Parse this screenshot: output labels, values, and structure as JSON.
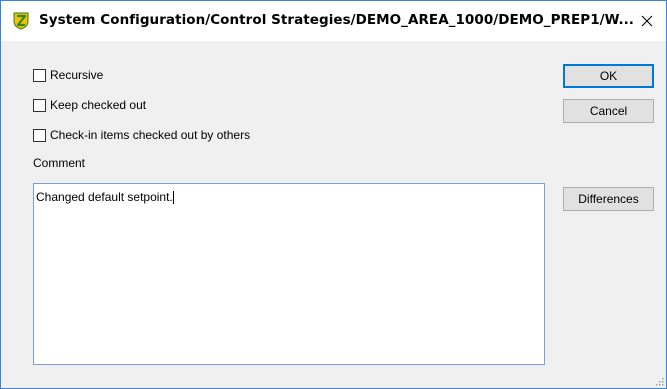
{
  "window": {
    "title": "System Configuration/Control Strategies/DEMO_AREA_1000/DEMO_PREP1/W..."
  },
  "options": {
    "recursive_label": "Recursive",
    "recursive_checked": false,
    "keep_checked_out_label": "Keep checked out",
    "keep_checked_out_checked": false,
    "checkin_others_label": "Check-in items checked out by others",
    "checkin_others_checked": false
  },
  "comment": {
    "label": "Comment",
    "value": "Changed default setpoint."
  },
  "buttons": {
    "ok_label": "OK",
    "cancel_label": "Cancel",
    "differences_label": "Differences"
  },
  "colors": {
    "window_border": "#3a82d6",
    "default_button_border": "#0078d7",
    "dialog_background": "#f0f0f0"
  },
  "icons": {
    "app": "app-shield-icon",
    "close": "close-icon",
    "resize": "resize-grip-icon"
  }
}
